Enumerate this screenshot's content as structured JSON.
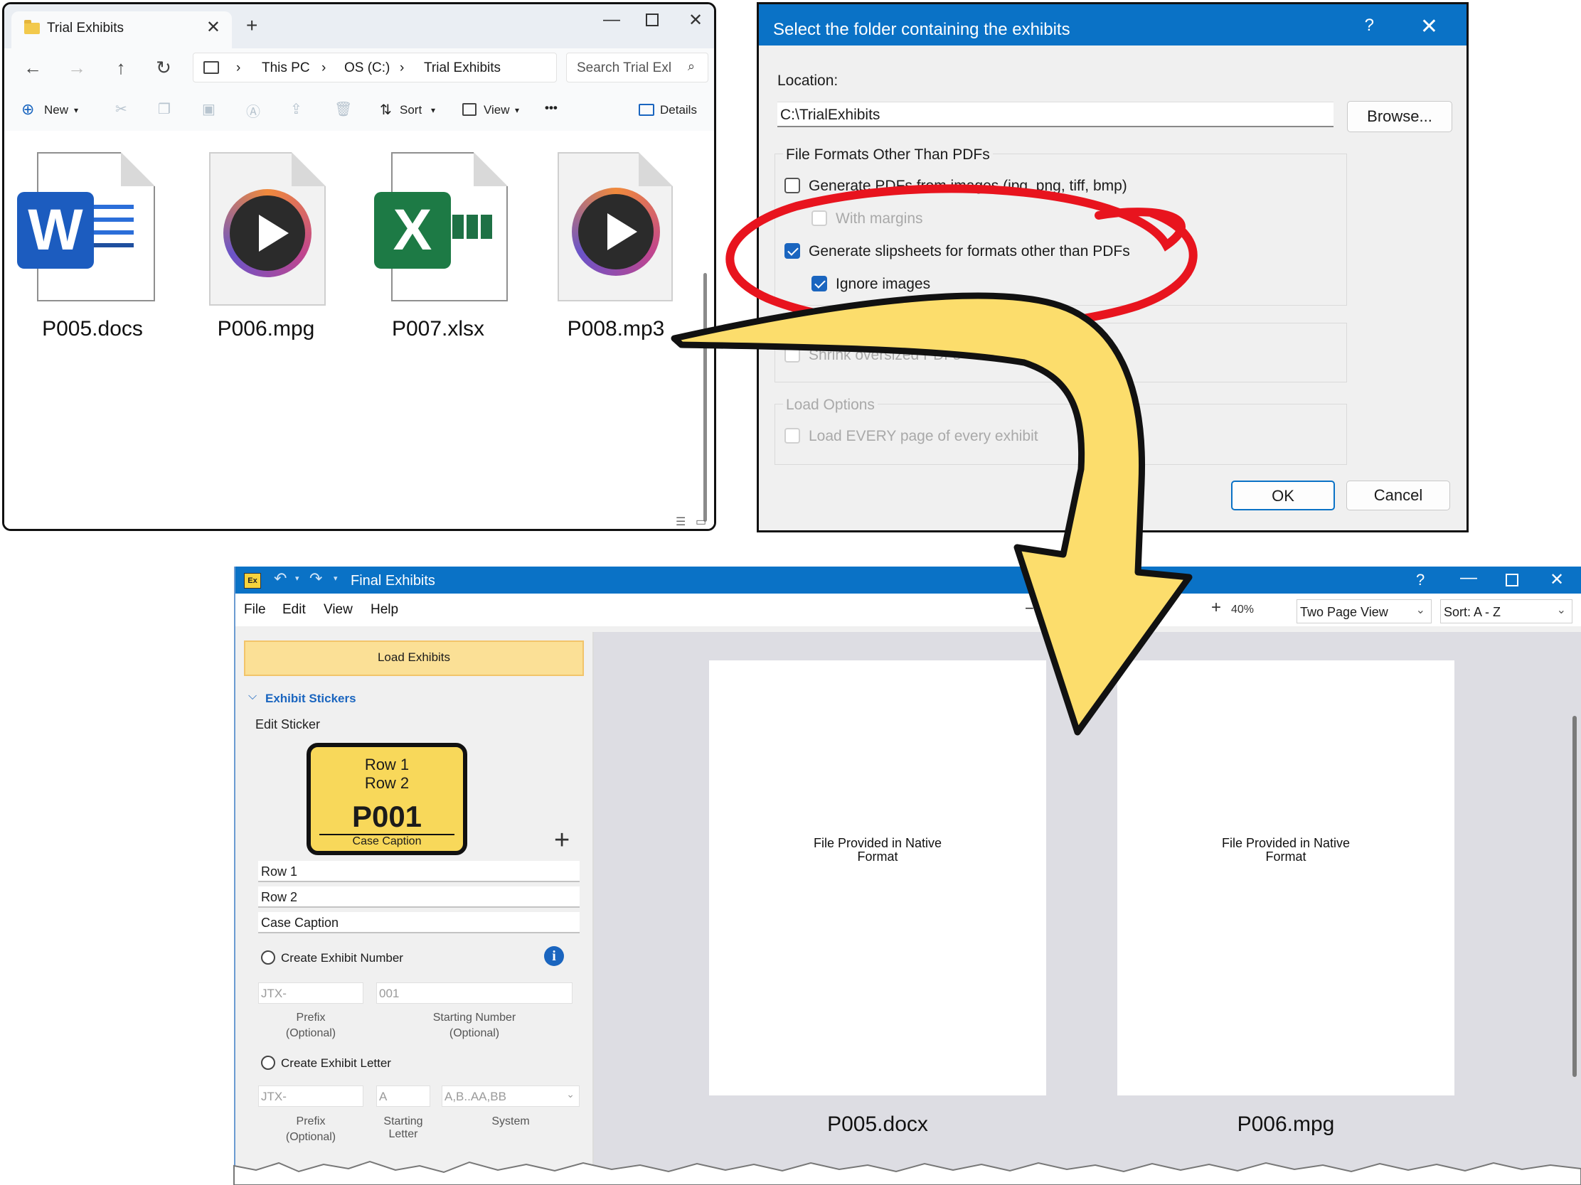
{
  "explorer": {
    "tab_title": "Trial Exhibits",
    "breadcrumb": [
      "This PC",
      "OS (C:)",
      "Trial Exhibits"
    ],
    "search_placeholder": "Search Trial Exl",
    "commands": {
      "new": "New",
      "sort": "Sort",
      "view": "View",
      "more": "•••",
      "details": "Details"
    },
    "files": [
      {
        "name": "P005.docs",
        "type": "word",
        "badge": "W"
      },
      {
        "name": "P006.mpg",
        "type": "media"
      },
      {
        "name": "P007.xlsx",
        "type": "excel",
        "badge": "X"
      },
      {
        "name": "P008.mp3",
        "type": "media"
      }
    ]
  },
  "dialog": {
    "title": "Select the folder containing the exhibits",
    "help": "?",
    "location_label": "Location:",
    "location_value": "C:\\TrialExhibits",
    "browse": "Browse...",
    "group1_title": "File Formats Other Than PDFs",
    "opt_gen_pdfs": "Generate PDFs from images (jpg, png, tiff, bmp)",
    "opt_margins": "With margins",
    "opt_slipsheets": "Generate slipsheets for formats other than PDFs",
    "opt_ignore": "Ignore images",
    "opt_shrink": "Shrink oversized PDFs",
    "group3_title": "Load Options",
    "opt_load_every": "Load EVERY page of every exhibit",
    "ok": "OK",
    "cancel": "Cancel"
  },
  "app": {
    "logo": "Ex",
    "title": "Final Exhibits",
    "help": "?",
    "menu": [
      "File",
      "Edit",
      "View",
      "Help"
    ],
    "zoom": "40%",
    "view_mode": "Two Page View",
    "sort": "Sort: A - Z",
    "load_button": "Load Exhibits",
    "section_title": "Exhibit Stickers",
    "edit_sticker": "Edit Sticker",
    "sticker": {
      "row1": "Row 1",
      "row2": "Row 2",
      "number": "P001",
      "caption": "Case Caption"
    },
    "fields": [
      "Row 1",
      "Row 2",
      "Case Caption"
    ],
    "create_number": "Create Exhibit Number",
    "number_prefix": "JTX-",
    "number_start": "001",
    "prefix_label": "Prefix",
    "optional": "(Optional)",
    "starting_number_label": "Starting Number",
    "create_letter": "Create Exhibit Letter",
    "letter_prefix": "JTX-",
    "letter_start": "A",
    "letter_system": "A,B..AA,BB",
    "starting_letter_label": "Starting Letter",
    "system_label": "System",
    "pages": [
      {
        "text": "File Provided in Native Format",
        "name": "P005.docx"
      },
      {
        "text": "File Provided in Native Format",
        "name": "P006.mpg"
      }
    ]
  },
  "colors": {
    "accent_blue": "#0a72c6",
    "annotation_red": "#e8141e",
    "arrow_yellow": "#fcdd6c",
    "sticker_yellow": "#f8d85a"
  }
}
